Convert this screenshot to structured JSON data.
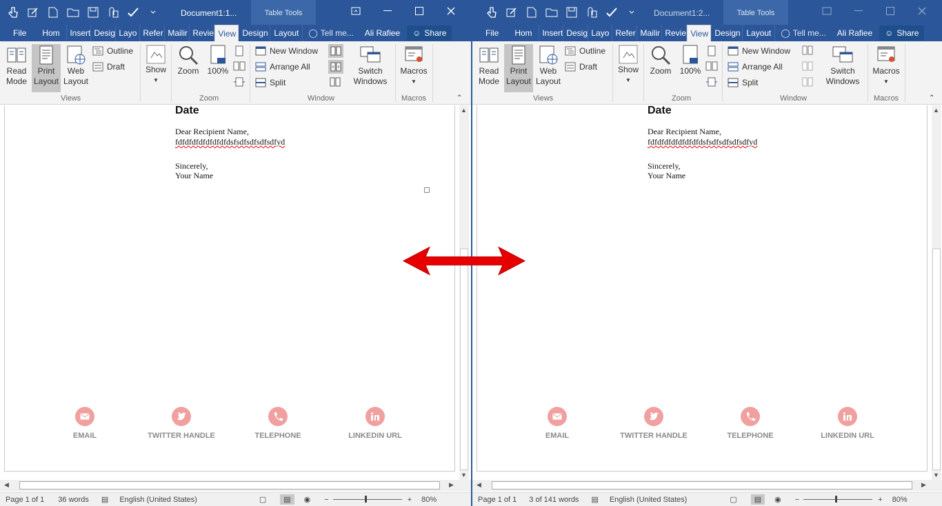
{
  "windows": [
    {
      "doc_title": "Document1:1...",
      "table_tools": "Table Tools",
      "tabs": [
        "File",
        "Hom",
        "Insert",
        "Desig",
        "Layo",
        "Refer",
        "Mailir",
        "Revie",
        "View",
        "Design",
        "Layout"
      ],
      "tell_me": "Tell me...",
      "user": "Ali Rafiee",
      "share": "Share",
      "ribbon": {
        "read_mode": [
          "Read",
          "Mode"
        ],
        "print_layout": [
          "Print",
          "Layout"
        ],
        "web_layout": [
          "Web",
          "Layout"
        ],
        "outline": "Outline",
        "draft": "Draft",
        "show": "Show",
        "zoom": "Zoom",
        "pct": "100%",
        "new_window": "New Window",
        "arrange_all": "Arrange All",
        "split": "Split",
        "switch_windows": [
          "Switch",
          "Windows"
        ],
        "macros": "Macros",
        "groups": {
          "views": "Views",
          "zoom": "Zoom",
          "window": "Window",
          "macros": "Macros"
        }
      },
      "doc": {
        "date": "Date",
        "greeting": "Dear Recipient Name,",
        "body": "fdfdfdfdfdfdfdfdsfsdfsdfsdfsdfyd",
        "closing": "Sincerely,",
        "name": "Your Name",
        "contacts": [
          "EMAIL",
          "TWITTER HANDLE",
          "TELEPHONE",
          "LINKEDIN URL"
        ]
      },
      "status": {
        "page": "Page 1 of 1",
        "words": "36 words",
        "lang": "English (United States)",
        "zoom": "80%"
      }
    },
    {
      "doc_title": "Document1:2...",
      "table_tools": "Table Tools",
      "tabs": [
        "File",
        "Hom",
        "Insert",
        "Desig",
        "Layo",
        "Refer",
        "Mailir",
        "Revie",
        "View",
        "Design",
        "Layout"
      ],
      "tell_me": "Tell me...",
      "user": "Ali Rafiee",
      "share": "Share",
      "ribbon": {
        "read_mode": [
          "Read",
          "Mode"
        ],
        "print_layout": [
          "Print",
          "Layout"
        ],
        "web_layout": [
          "Web",
          "Layout"
        ],
        "outline": "Outline",
        "draft": "Draft",
        "show": "Show",
        "zoom": "Zoom",
        "pct": "100%",
        "new_window": "New Window",
        "arrange_all": "Arrange All",
        "split": "Split",
        "switch_windows": [
          "Switch",
          "Windows"
        ],
        "macros": "Macros",
        "groups": {
          "views": "Views",
          "zoom": "Zoom",
          "window": "Window",
          "macros": "Macros"
        }
      },
      "doc": {
        "date": "Date",
        "greeting": "Dear Recipient Name,",
        "body": "fdfdfdfdfdfdfdfdsfsdfsdfsdfsdfyd",
        "closing": "Sincerely,",
        "name": "Your Name",
        "contacts": [
          "EMAIL",
          "TWITTER HANDLE",
          "TELEPHONE",
          "LINKEDIN URL"
        ]
      },
      "status": {
        "page": "Page 1 of 1",
        "words": "3 of 141 words",
        "lang": "English (United States)",
        "zoom": "80%"
      }
    }
  ],
  "colors": {
    "brand": "#2b579a",
    "arrow": "#e60000",
    "contact_circle": "#f1a0a0"
  },
  "arrow_icon": "double-headed-arrow-icon"
}
